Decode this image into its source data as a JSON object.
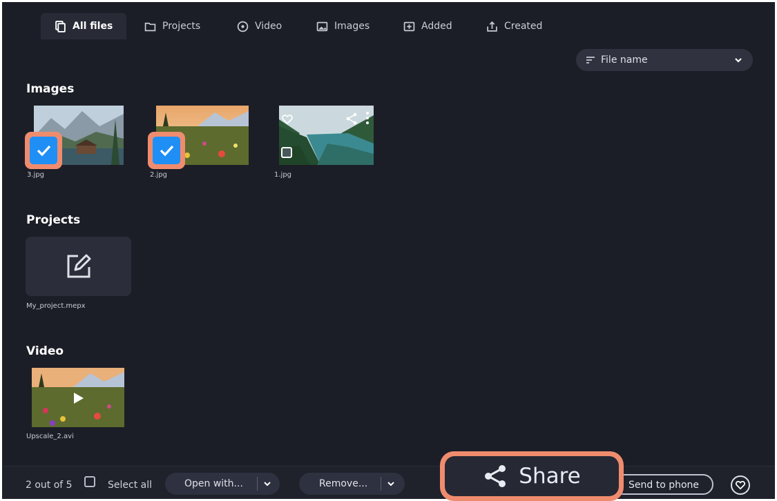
{
  "tabs": [
    {
      "label": "All files",
      "icon": "files-icon",
      "active": true
    },
    {
      "label": "Projects",
      "icon": "folder-icon"
    },
    {
      "label": "Video",
      "icon": "video-icon"
    },
    {
      "label": "Images",
      "icon": "image-icon"
    },
    {
      "label": "Added",
      "icon": "added-icon"
    },
    {
      "label": "Created",
      "icon": "created-icon"
    }
  ],
  "sort": {
    "label": "File name",
    "icon": "sort-icon"
  },
  "sections": {
    "images": {
      "title": "Images",
      "items": [
        {
          "name": "3.jpg",
          "selected": true
        },
        {
          "name": "2.jpg",
          "selected": true
        },
        {
          "name": "1.jpg",
          "selected": false
        }
      ]
    },
    "projects": {
      "title": "Projects",
      "items": [
        {
          "name": "My_project.mepx"
        }
      ]
    },
    "video": {
      "title": "Video",
      "items": [
        {
          "name": "Upscale_2.avi"
        }
      ]
    }
  },
  "bottom": {
    "count": "2 out of 5",
    "select_all": "Select all",
    "open_with": "Open with...",
    "remove": "Remove...",
    "share": "Share",
    "send_to_phone": "Send to phone"
  },
  "colors": {
    "accent_highlight": "#f08c6e",
    "checkbox_blue": "#1f8ff5",
    "background": "#1c1e27"
  }
}
